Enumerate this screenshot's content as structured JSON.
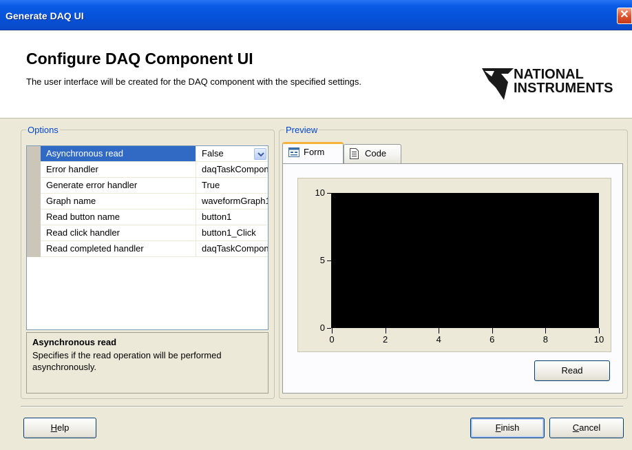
{
  "window": {
    "title": "Generate DAQ UI",
    "close_symbol": "✕"
  },
  "header": {
    "heading": "Configure DAQ Component UI",
    "description": "The user interface will be created for the DAQ component with the specified settings.",
    "logo": {
      "line1": "NATIONAL",
      "line2": "INSTRUMENTS",
      "icon": "ni-eagle-logo-icon"
    }
  },
  "options": {
    "label": "Options",
    "properties": [
      {
        "name": "Asynchronous read",
        "value": "False",
        "selected": true
      },
      {
        "name": "Error handler",
        "value": "daqTaskComponen"
      },
      {
        "name": "Generate error handler",
        "value": "True"
      },
      {
        "name": "Graph name",
        "value": "waveformGraph1"
      },
      {
        "name": "Read button name",
        "value": "button1"
      },
      {
        "name": "Read click handler",
        "value": "button1_Click"
      },
      {
        "name": "Read completed handler",
        "value": "daqTaskComponen"
      }
    ],
    "description_title": "Asynchronous read",
    "description_text": "Specifies if the read operation will be performed asynchronously."
  },
  "preview": {
    "label": "Preview",
    "tabs": [
      {
        "label": "Form",
        "icon": "form-icon",
        "active": true
      },
      {
        "label": "Code",
        "icon": "code-file-icon",
        "active": false
      }
    ],
    "read_button": "Read"
  },
  "chart_data": {
    "type": "line",
    "title": "",
    "xlabel": "",
    "ylabel": "",
    "x": [],
    "series": [],
    "xlim": [
      0,
      10
    ],
    "ylim": [
      0,
      10
    ],
    "x_ticks": [
      "0",
      "2",
      "4",
      "6",
      "8",
      "10"
    ],
    "y_ticks": [
      "10",
      "5",
      "0"
    ],
    "plot_background": "#000000",
    "grid": false
  },
  "footer": {
    "help": {
      "mnemonic": "H",
      "rest": "elp"
    },
    "finish": {
      "mnemonic": "F",
      "rest": "inish"
    },
    "cancel": {
      "mnemonic": "C",
      "rest": "ancel"
    }
  },
  "colors": {
    "titlebar": "#0551d8",
    "selected_row": "#316ac5",
    "group_label": "#0046d5",
    "active_tab_accent": "#f4b43b",
    "dialog_bg": "#ece9d8"
  }
}
